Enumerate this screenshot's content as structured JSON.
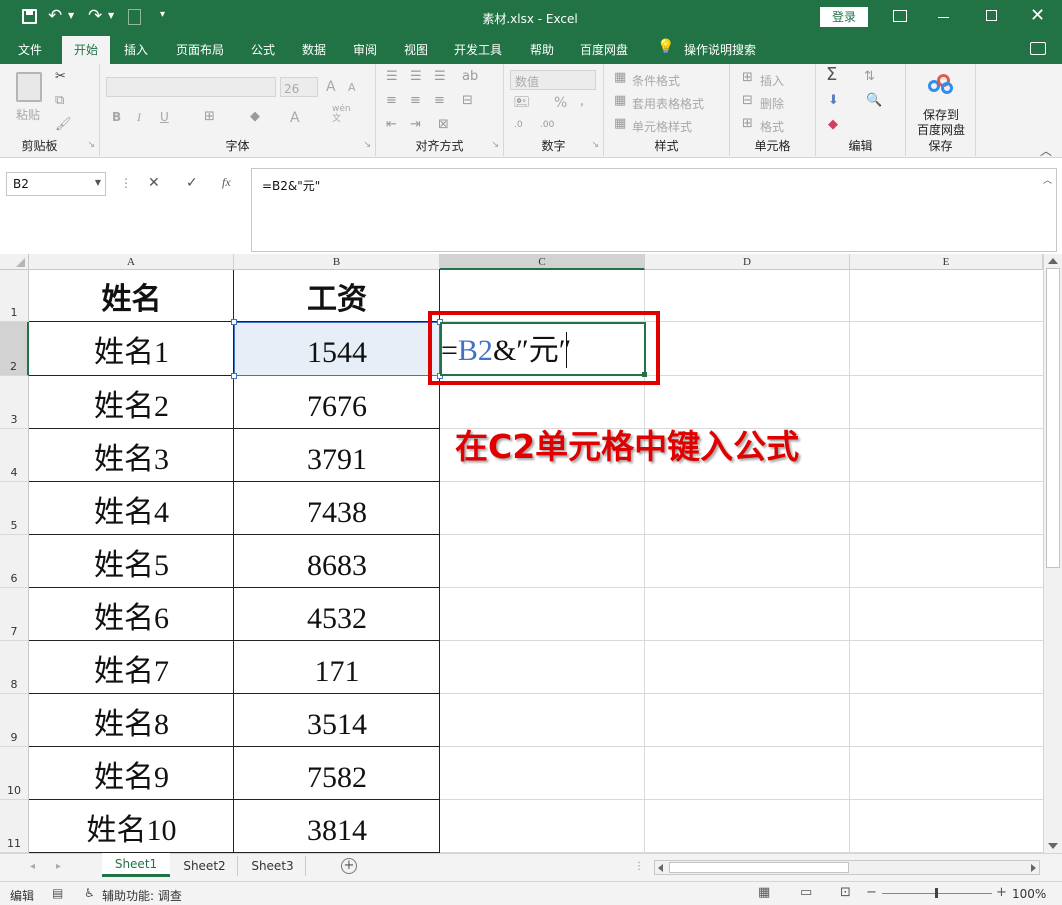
{
  "title": "素材.xlsx  -  Excel",
  "login_label": "登录",
  "qat_icons": [
    "save-icon",
    "undo-icon",
    "redo-icon",
    "print-preview-icon",
    "customize-icon"
  ],
  "tabs": [
    "文件",
    "开始",
    "插入",
    "页面布局",
    "公式",
    "数据",
    "审阅",
    "视图",
    "开发工具",
    "帮助",
    "百度网盘",
    "操作说明搜索"
  ],
  "active_tab": "开始",
  "ribbon": {
    "clipboard": {
      "paste": "粘贴",
      "label": "剪贴板"
    },
    "font": {
      "size": "26",
      "bold": "B",
      "italic": "I",
      "underline": "U",
      "grow": "A",
      "shrink": "A",
      "label": "字体",
      "wen": "wén\n文"
    },
    "align": {
      "label": "对齐方式"
    },
    "number": {
      "format": "数值",
      "percent": "%",
      "label": "数字"
    },
    "styles": {
      "cond": "条件格式",
      "table": "套用表格格式",
      "cell": "单元格样式",
      "label": "样式"
    },
    "cells": {
      "insert": "插入",
      "delete": "删除",
      "format": "格式",
      "label": "单元格"
    },
    "editing": {
      "label": "编辑"
    },
    "save": {
      "line1": "保存到",
      "line2": "百度网盘",
      "label": "保存"
    }
  },
  "namebox": "B2",
  "formula": "=B2&\"元\"",
  "fx": "fx",
  "columns": [
    "A",
    "B",
    "C",
    "D",
    "E"
  ],
  "rows": [
    "1",
    "2",
    "3",
    "4",
    "5",
    "6",
    "7",
    "8",
    "9",
    "10",
    "11"
  ],
  "table": {
    "headers": [
      "姓名",
      "工资"
    ],
    "names": [
      "姓名1",
      "姓名2",
      "姓名3",
      "姓名4",
      "姓名5",
      "姓名6",
      "姓名7",
      "姓名8",
      "姓名9",
      "姓名10"
    ],
    "salaries": [
      "1544",
      "7676",
      "3791",
      "7438",
      "8683",
      "4532",
      "171",
      "3514",
      "7582",
      "3814"
    ]
  },
  "c2_edit": {
    "eq": "=",
    "ref": "B2",
    "rest": "&″元″"
  },
  "annotation": "在C2单元格中键入公式",
  "sheets": [
    "Sheet1",
    "Sheet2",
    "Sheet3"
  ],
  "active_sheet": "Sheet1",
  "status": {
    "mode": "编辑",
    "accessibility": "辅助功能: 调查",
    "zoom": "100%"
  },
  "colors": {
    "brand": "#217346",
    "formula_ref": "#4472c4",
    "annotation": "#e00000",
    "highlight_box": "#e00000"
  }
}
